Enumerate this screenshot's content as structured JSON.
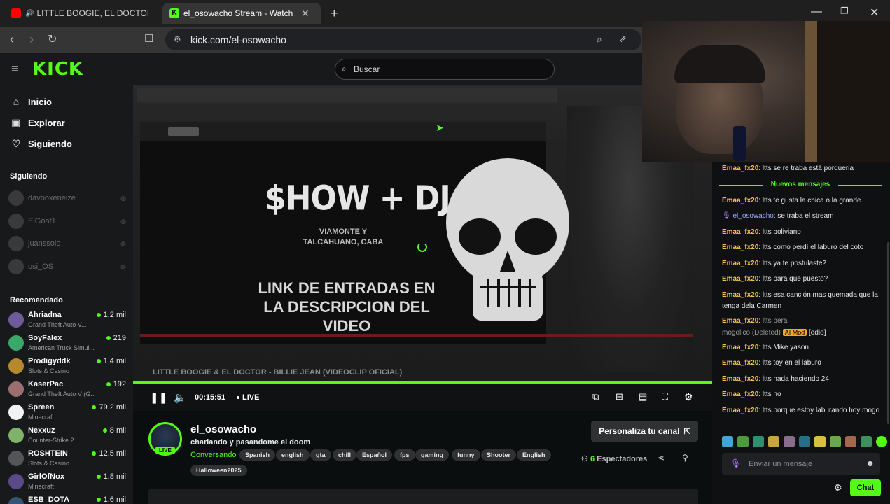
{
  "browser": {
    "tabs": [
      {
        "title": "LITTLE BOOGIE, EL DOCTOR & TU",
        "active": false
      },
      {
        "title": "el_osowacho Stream - Watch Live",
        "active": true
      }
    ],
    "new_tab": "+",
    "url": "kick.com/el-osowacho"
  },
  "header": {
    "logo": "KICK",
    "search_placeholder": "Buscar"
  },
  "sidebar": {
    "nav": [
      {
        "label": "Inicio",
        "icon": "home-icon"
      },
      {
        "label": "Explorar",
        "icon": "compass-icon"
      },
      {
        "label": "Siguiendo",
        "icon": "heart-icon"
      }
    ],
    "following_title": "Siguiendo",
    "following": [
      {
        "name": "davooxeneize"
      },
      {
        "name": "ElGoat1"
      },
      {
        "name": "juanssolo"
      },
      {
        "name": "osi_OS"
      }
    ],
    "recommended_title": "Recomendado",
    "recommended": [
      {
        "name": "Ahriadna",
        "category": "Grand Theft Auto V...",
        "viewers": "1,2 mil",
        "color": "#6f5a9a"
      },
      {
        "name": "SoyFalex",
        "category": "American Truck Simul...",
        "viewers": "219",
        "color": "#3aa86b"
      },
      {
        "name": "Prodigyddk",
        "category": "Slots & Casino",
        "viewers": "1,4 mil",
        "color": "#b58a2c"
      },
      {
        "name": "KaserPac",
        "category": "Grand Theft Auto V (G...",
        "viewers": "192",
        "color": "#9b6f6f"
      },
      {
        "name": "Spreen",
        "category": "Minecraft",
        "viewers": "79,2 mil",
        "color": "#f2f2f2"
      },
      {
        "name": "Nexxuz",
        "category": "Counter-Strike 2",
        "viewers": "8 mil",
        "color": "#7fb26a"
      },
      {
        "name": "ROSHTEIN",
        "category": "Slots & Casino",
        "viewers": "12,5 mil",
        "color": "#555555"
      },
      {
        "name": "GirlOfNox",
        "category": "Minecraft",
        "viewers": "1,8 mil",
        "color": "#5a4a8a"
      },
      {
        "name": "ESB_DOTA",
        "category": "",
        "viewers": "1,6 mil",
        "color": "#335577"
      }
    ]
  },
  "player": {
    "poster_title": "$HOW + DJ SET",
    "poster_sub": "VIAMONTE Y TALCAHUANO, CABA",
    "poster_link": "LINK DE ENTRADAS EN LA DESCRIPCION DEL VIDEO",
    "inner_caption": "LITTLE BOOGIE & EL DOCTOR - BILLIE JEAN (VIDEOCLIP OFICIAL)",
    "time": "00:15:51",
    "live_label": "LIVE",
    "progress": 1.0
  },
  "stream": {
    "channel": "el_osowacho",
    "live_badge": "LIVE",
    "title": "charlando y pasandome el doom",
    "category": "Conversando",
    "tags": [
      "Spanish",
      "english",
      "gta",
      "chill",
      "Español",
      "fps",
      "gaming",
      "funny",
      "Shooter",
      "English",
      "Halloween2025"
    ],
    "customize_label": "Personaliza tu canal",
    "viewers_count": "6",
    "viewers_label": "Espectadores"
  },
  "chat": {
    "messages": [
      {
        "user": "Emaa_fx20",
        "text": "ltts se re traba está porqueria"
      },
      {
        "user": "Emaa_fx20",
        "text": "ltts te gusta la chica o la grande"
      },
      {
        "user": "el_osowacho",
        "text": "se traba el stream"
      },
      {
        "user": "Emaa_fx20",
        "text": "ltts boliviano"
      },
      {
        "user": "Emaa_fx20",
        "text": "ltts como perdí el laburo del coto"
      },
      {
        "user": "Emaa_fx20",
        "text": "ltts ya te postulaste?"
      },
      {
        "user": "Emaa_fx20",
        "text": "ltts para que puesto?"
      },
      {
        "user": "Emaa_fx20",
        "text": "ltts esa canción mas quemada que la tenga dela Carmen"
      },
      {
        "user": "Emaa_fx20",
        "text": "ltts pera"
      },
      {
        "user": "mogolico",
        "deleted": "(Deleted)",
        "badge": "AI Mod",
        "text": "[odio]"
      },
      {
        "user": "Emaa_fx20",
        "text": "ltts Mike yason"
      },
      {
        "user": "Emaa_fx20",
        "text": "ltts toy en el laburo"
      },
      {
        "user": "Emaa_fx20",
        "text": "ltts nada haciendo 24"
      },
      {
        "user": "Emaa_fx20",
        "text": "ltts no"
      },
      {
        "user": "Emaa_fx20",
        "text": "ltts porque estoy laburando hoy mogo"
      }
    ],
    "new_messages_label": "Nuevos mensajes",
    "input_placeholder": "Enviar un mensaje",
    "send_label": "Chat"
  },
  "colors": {
    "accent": "#53fc18",
    "username": "#f0c24b",
    "background": "#0b0e0f"
  }
}
